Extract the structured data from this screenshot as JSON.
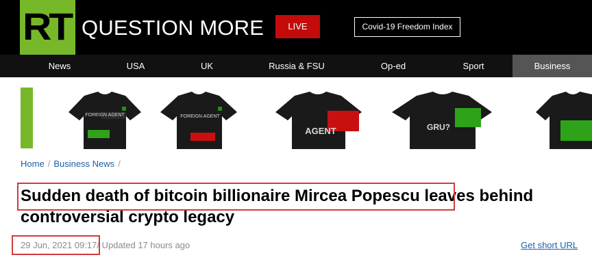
{
  "header": {
    "logo_text": "RT",
    "slogan": "QUESTION MORE",
    "live_label": "LIVE",
    "covid_label": "Covid-19 Freedom Index"
  },
  "nav": {
    "items": [
      {
        "label": "News"
      },
      {
        "label": "USA"
      },
      {
        "label": "UK"
      },
      {
        "label": "Russia & FSU"
      },
      {
        "label": "Op-ed"
      },
      {
        "label": "Sport"
      },
      {
        "label": "Business"
      }
    ],
    "active": "Business"
  },
  "banner": {
    "shirt_texts": [
      "FOREIGN AGENT",
      "FOREIGN AGENT",
      "AGENT",
      "GRU?",
      ""
    ]
  },
  "breadcrumb": {
    "home": "Home",
    "section": "Business News",
    "separator": "/"
  },
  "article": {
    "title": "Sudden death of bitcoin billionaire Mircea Popescu leaves behind controversial crypto legacy",
    "published": "29 Jun, 2021 09:17",
    "updated": "/ Updated 17 hours ago",
    "short_url_label": "Get short URL"
  },
  "colors": {
    "brand_green": "#77b82a",
    "live_red": "#c30b0b",
    "highlight_red": "#d03b3b",
    "link_blue": "#1b5fa5"
  }
}
